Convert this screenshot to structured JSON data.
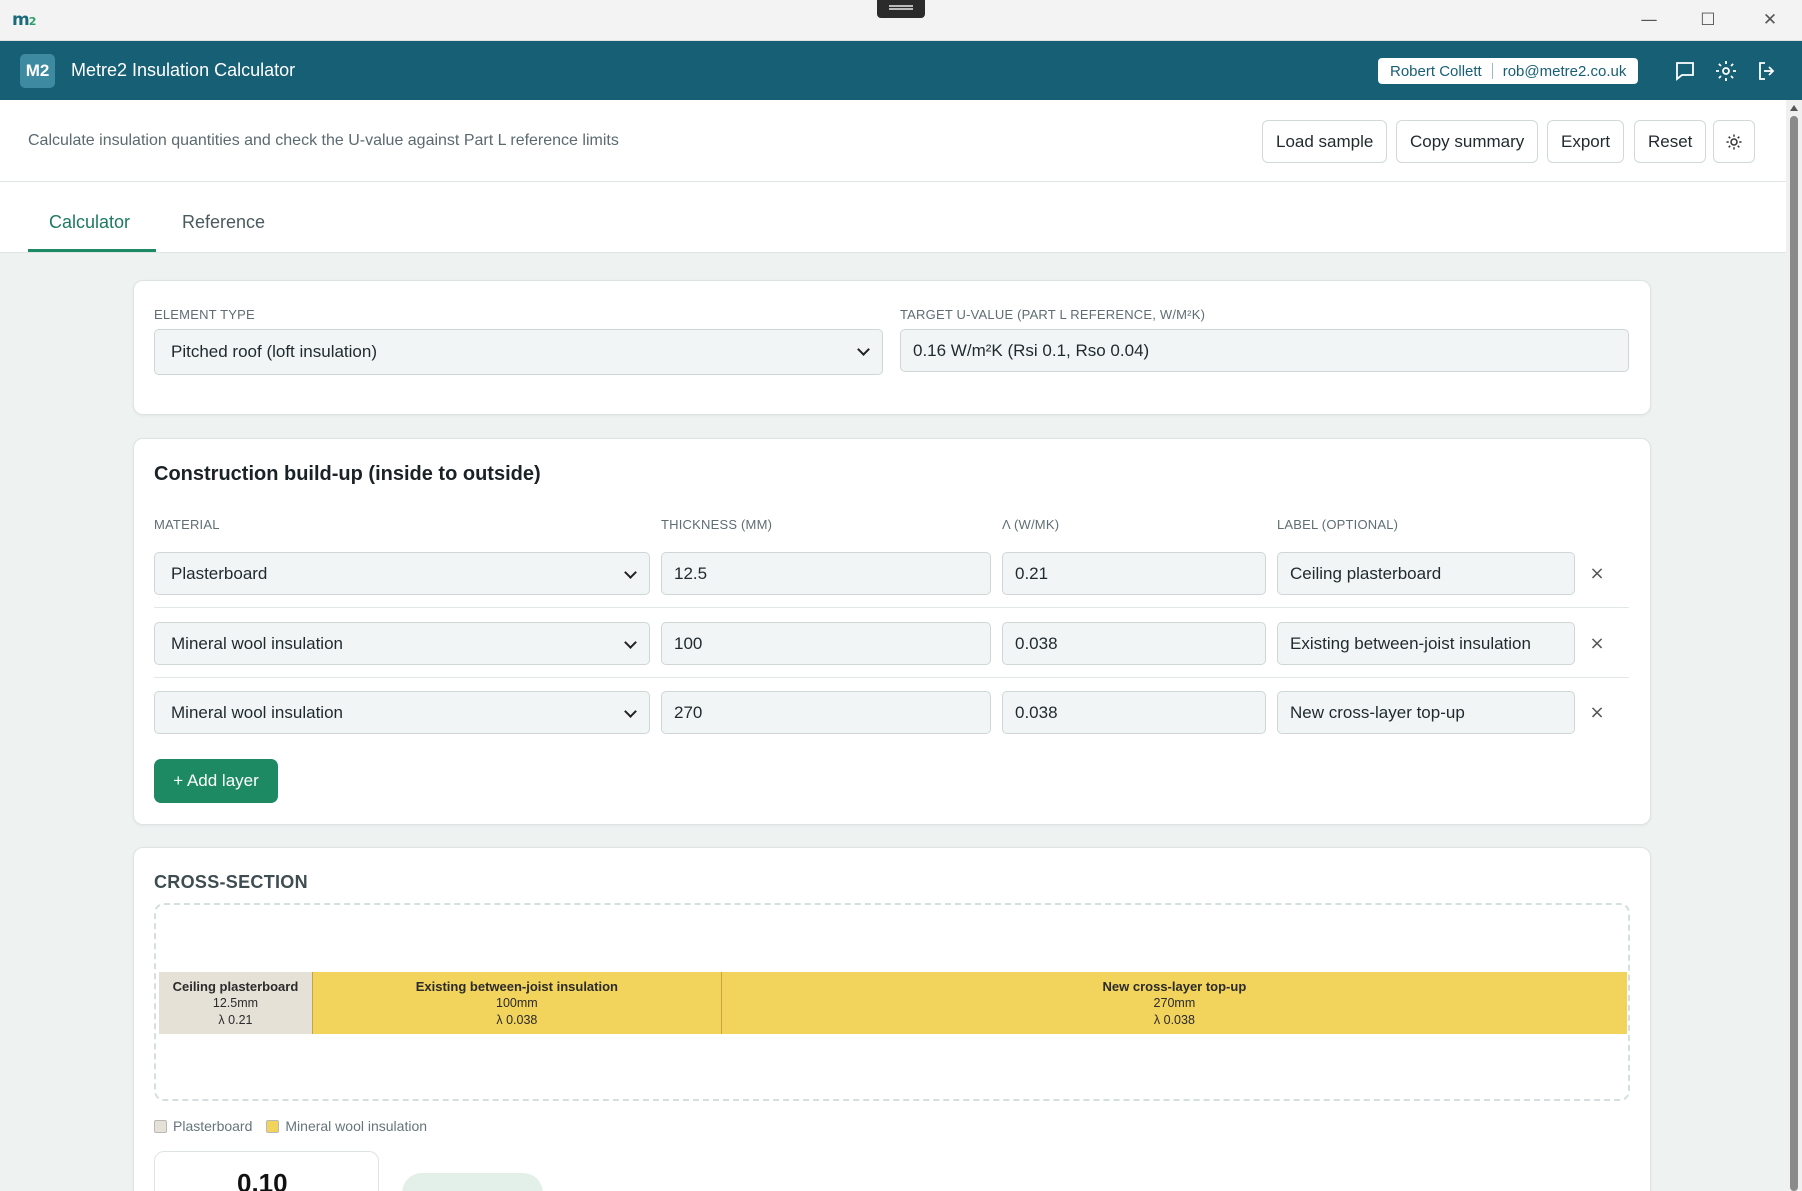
{
  "window": {
    "logo": "m",
    "logo_sup": "2",
    "minimize_glyph": "—",
    "maximize_glyph": "☐",
    "close_glyph": "✕"
  },
  "header": {
    "logo_badge": "M2",
    "title": "Metre2 Insulation Calculator",
    "user_name": "Robert Collett",
    "user_email": "rob@metre2.co.uk",
    "icons": [
      "chat-icon",
      "gear-icon",
      "logout-icon"
    ]
  },
  "subheader": {
    "description": "Calculate insulation quantities and check the U-value against Part L reference limits",
    "buttons": {
      "load_sample": "Load sample",
      "copy_summary": "Copy summary",
      "export": "Export",
      "reset": "Reset"
    },
    "theme_icon": "sun-icon"
  },
  "tabs": [
    {
      "label": "Calculator",
      "active": true
    },
    {
      "label": "Reference",
      "active": false
    }
  ],
  "element_card": {
    "element_type_label": "ELEMENT TYPE",
    "element_type_value": "Pitched roof (loft insulation)",
    "target_label": "TARGET U-VALUE (PART L REFERENCE, W/M²K)",
    "target_value": "0.16 W/m²K (Rsi 0.1, Rso 0.04)"
  },
  "buildup": {
    "title": "Construction build-up (inside to outside)",
    "columns": {
      "material": "MATERIAL",
      "thickness": "THICKNESS (MM)",
      "lambda": "Λ (W/MK)",
      "label": "LABEL (OPTIONAL)"
    },
    "layers": [
      {
        "material": "Plasterboard",
        "thickness": "12.5",
        "lambda": "0.21",
        "label": "Ceiling plasterboard"
      },
      {
        "material": "Mineral wool insulation",
        "thickness": "100",
        "lambda": "0.038",
        "label": "Existing between-joist insulation"
      },
      {
        "material": "Mineral wool insulation",
        "thickness": "270",
        "lambda": "0.038",
        "label": "New cross-layer top-up"
      }
    ],
    "remove_glyph": "×",
    "add_button": "+ Add layer"
  },
  "cross_section": {
    "title": "CROSS-SECTION",
    "segments": [
      {
        "name": "Ceiling plasterboard",
        "thickness": "12.5mm",
        "lambda": "λ 0.21",
        "color": "#e6e1d6",
        "weight": 134
      },
      {
        "name": "Existing between-joist insulation",
        "thickness": "100mm",
        "lambda": "λ 0.038",
        "color": "#f2d35c",
        "weight": 356
      },
      {
        "name": "New cross-layer top-up",
        "thickness": "270mm",
        "lambda": "λ 0.038",
        "color": "#f2d35c",
        "weight": 788
      }
    ],
    "legend": [
      {
        "label": "Plasterboard",
        "color": "#e6e1d6"
      },
      {
        "label": "Mineral wool insulation",
        "color": "#f2d35c"
      }
    ],
    "result_value": "0.10"
  }
}
